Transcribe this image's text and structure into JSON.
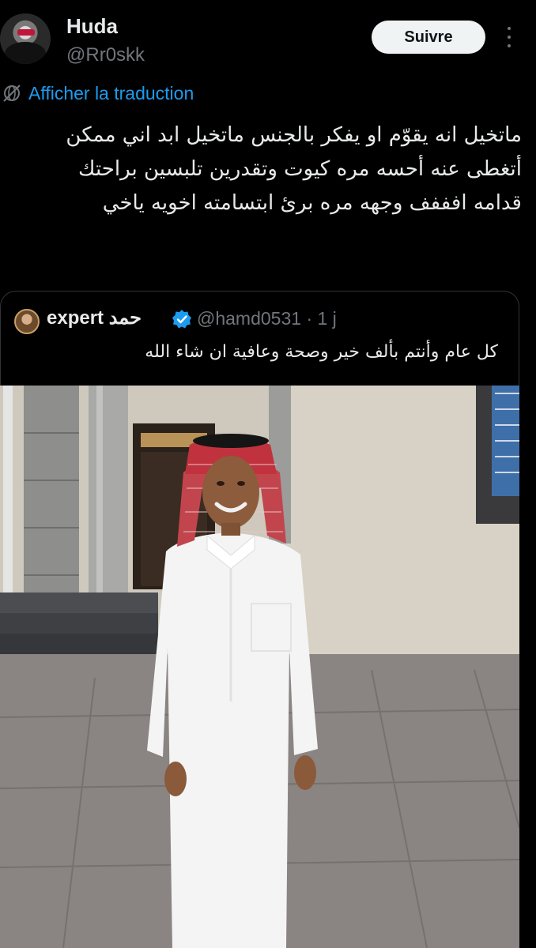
{
  "author": {
    "name": "Huda",
    "handle": "@Rr0skk"
  },
  "actions": {
    "follow_label": "Suivre"
  },
  "translation": {
    "label": "Afficher la traduction"
  },
  "tweet": {
    "text": "ماتخيل انه يقوّم او يفكر بالجنس ماتخيل ابد اني ممكن أتغطى عنه أحسه مره كيوت وتقدرين تلبسين براحتك قدامه افففف وجهه مره برئ ابتسامته اخويه ياخي"
  },
  "quoted_tweet": {
    "display_name": "expert حمد",
    "handle_time": "@hamd0531 · 1 j",
    "text": "كل عام وأنتم بألف خير وصحة وعافية ان شاء الله"
  },
  "icons": {
    "more": "more-vertical-icon",
    "translate": "globe-slash-icon",
    "verified": "verified-badge-icon"
  },
  "colors": {
    "background": "#000000",
    "accent": "#1d9bf0",
    "text": "#e7e9ea",
    "muted": "#71767b",
    "button_bg": "#eff3f4"
  }
}
